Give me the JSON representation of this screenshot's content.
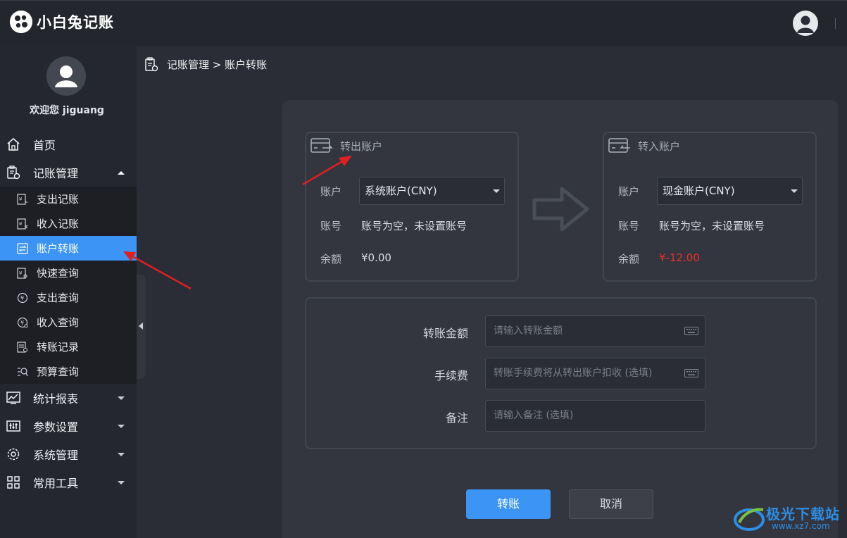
{
  "app": {
    "name": "小白兔记账"
  },
  "sidebar": {
    "welcome": "欢迎您 jiguang",
    "items": [
      {
        "label": "首页"
      },
      {
        "label": "记账管理",
        "expanded": true
      },
      {
        "label": "统计报表"
      },
      {
        "label": "参数设置"
      },
      {
        "label": "系统管理"
      },
      {
        "label": "常用工具"
      }
    ],
    "submenu": [
      {
        "label": "支出记账"
      },
      {
        "label": "收入记账"
      },
      {
        "label": "账户转账",
        "active": true
      },
      {
        "label": "快速查询"
      },
      {
        "label": "支出查询"
      },
      {
        "label": "收入查询"
      },
      {
        "label": "转账记录"
      },
      {
        "label": "预算查询"
      }
    ]
  },
  "breadcrumb": {
    "text": "记账管理 > 账户转账"
  },
  "transfer_out": {
    "title": "转出账户",
    "account_label": "账户",
    "account_value": "系统账户(CNY)",
    "number_label": "账号",
    "number_value": "账号为空，未设置账号",
    "balance_label": "余额",
    "balance_value": "¥0.00"
  },
  "transfer_in": {
    "title": "转入账户",
    "account_label": "账户",
    "account_value": "现金账户(CNY)",
    "number_label": "账号",
    "number_value": "账号为空，未设置账号",
    "balance_label": "余额",
    "balance_value": "¥-12.00"
  },
  "form": {
    "amount_label": "转账金额",
    "amount_placeholder": "请输入转账金额",
    "fee_label": "手续费",
    "fee_placeholder": "转账手续费将从转出账户扣收 (选填)",
    "note_label": "备注",
    "note_placeholder": "请输入备注 (选填)"
  },
  "buttons": {
    "submit": "转账",
    "cancel": "取消"
  },
  "watermark": {
    "text": "极光下载站",
    "url": "www.xz7.com"
  },
  "colors": {
    "accent": "#3c95f5",
    "negative": "#ef2c2c",
    "annotation": "#e02020"
  }
}
